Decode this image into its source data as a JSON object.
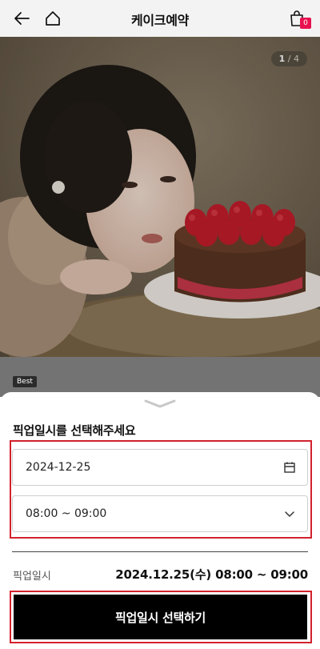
{
  "header": {
    "title": "케이크예약",
    "cart_count": "0"
  },
  "gallery": {
    "current": "1",
    "separator": " / ",
    "total": "4"
  },
  "product": {
    "badge": "Best"
  },
  "sheet": {
    "title": "픽업일시를 선택해주세요",
    "date_value": "2024-12-25",
    "time_value": "08:00 ~ 09:00",
    "summary_label": "픽업일시",
    "summary_value": "2024.12.25(수) 08:00 ~ 09:00",
    "confirm_label": "픽업일시 선택하기"
  },
  "colors": {
    "highlight": "#d2222d",
    "badge": "#e8114f",
    "cta": "#000000"
  },
  "icons": [
    "back-arrow-icon",
    "home-icon",
    "shopping-bag-icon",
    "chevron-down-handle-icon",
    "calendar-icon",
    "chevron-down-icon"
  ]
}
